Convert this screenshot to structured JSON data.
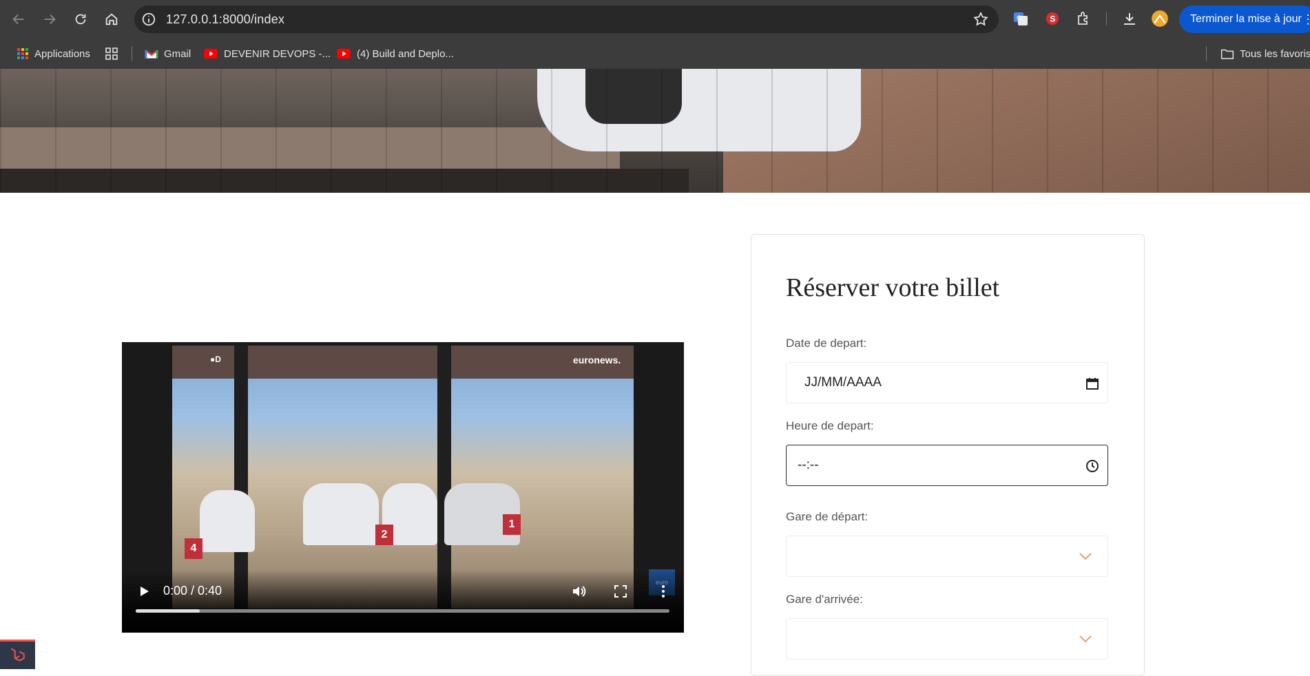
{
  "browser": {
    "url": "127.0.0.1:8000/index",
    "update_label": "Terminer la mise à jour",
    "extensions": [
      "google-translate-icon",
      "s-extension-icon",
      "puzzle-extensions-icon",
      "download-icon",
      "profile-avatar-icon"
    ]
  },
  "bookmarks": {
    "apps_label": "Applications",
    "items": [
      {
        "label": "Gmail",
        "icon": "gmail-icon"
      },
      {
        "label": "DEVENIR DEVOPS -...",
        "icon": "youtube-icon"
      },
      {
        "label": "(4) Build and Deplo...",
        "icon": "youtube-icon"
      }
    ],
    "all_bookmarks_label": "Tous les favoris"
  },
  "video": {
    "time": "0:00 / 0:40",
    "progress": 0.12,
    "channel_logo": "euronews.",
    "corner_logo": "●D",
    "platform_signs": [
      "4",
      "2",
      "1"
    ]
  },
  "booking_form": {
    "title": "Réserver votre billet",
    "date_label": "Date de depart:",
    "date_placeholder": "JJ/MM/AAAA",
    "time_label": "Heure de depart:",
    "time_placeholder": "--:--",
    "departure_station_label": "Gare de départ:",
    "departure_station_value": "",
    "arrival_station_label": "Gare d'arrivée:",
    "arrival_station_value": ""
  },
  "colors": {
    "chrome_bg": "#3c3c3c",
    "omnibox_bg": "#282828",
    "update_button": "#0b57d0",
    "select_chevron": "#e0a070",
    "laravel_red": "#f55247"
  }
}
